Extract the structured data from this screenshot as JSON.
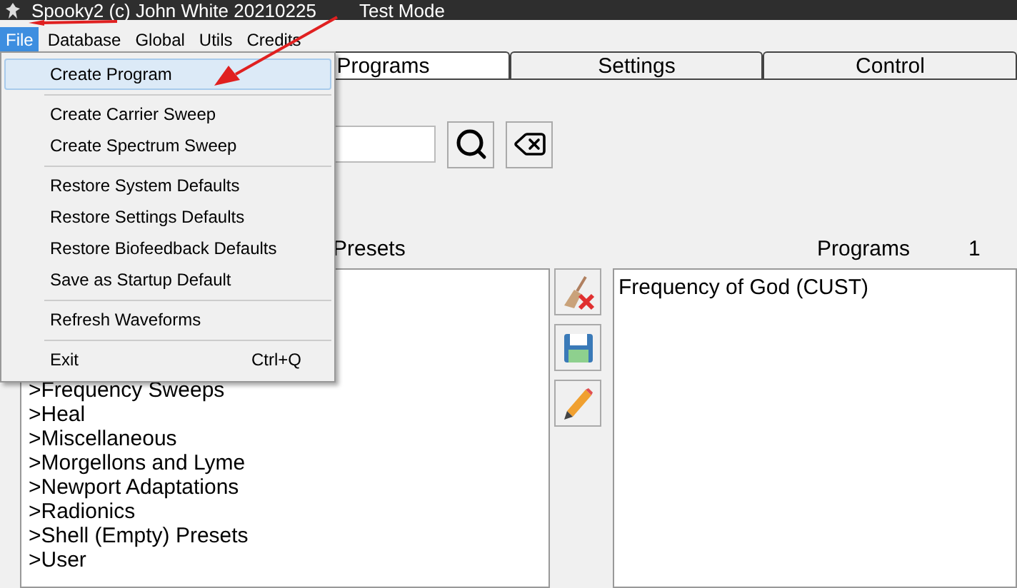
{
  "window": {
    "title": "Spooky2 (c) John White 20210225",
    "mode": "Test Mode"
  },
  "menu_bar": [
    {
      "label": "File",
      "selected": true
    },
    {
      "label": "Database",
      "selected": false
    },
    {
      "label": "Global",
      "selected": false
    },
    {
      "label": "Utils",
      "selected": false
    },
    {
      "label": "Credits",
      "selected": false
    }
  ],
  "file_menu": [
    {
      "kind": "item",
      "label": "Create Program",
      "selected": true
    },
    {
      "kind": "separator"
    },
    {
      "kind": "item",
      "label": "Create Carrier Sweep",
      "selected": false
    },
    {
      "kind": "item",
      "label": "Create Spectrum Sweep",
      "selected": false
    },
    {
      "kind": "separator"
    },
    {
      "kind": "item",
      "label": "Restore System Defaults",
      "selected": false
    },
    {
      "kind": "item",
      "label": "Restore Settings Defaults",
      "selected": false
    },
    {
      "kind": "item",
      "label": "Restore Biofeedback Defaults",
      "selected": false
    },
    {
      "kind": "item",
      "label": "Save as Startup Default",
      "selected": false
    },
    {
      "kind": "separator"
    },
    {
      "kind": "item",
      "label": "Refresh Waveforms",
      "selected": false
    },
    {
      "kind": "separator"
    },
    {
      "kind": "item",
      "label": "Exit",
      "selected": false,
      "shortcut": "Ctrl+Q"
    }
  ],
  "tabs": [
    {
      "label": "Programs",
      "selected": true
    },
    {
      "label": "Settings",
      "selected": false
    },
    {
      "label": "Control",
      "selected": false
    }
  ],
  "presets": {
    "label": "Presets",
    "items": [
      ">Frequency Sweeps",
      ">Heal",
      ">Miscellaneous",
      ">Morgellons and Lyme",
      ">Newport Adaptations",
      ">Radionics",
      ">Shell (Empty) Presets",
      ">User"
    ]
  },
  "programs": {
    "label": "Programs",
    "count": "1",
    "items": [
      "Frequency of God (CUST)"
    ]
  }
}
